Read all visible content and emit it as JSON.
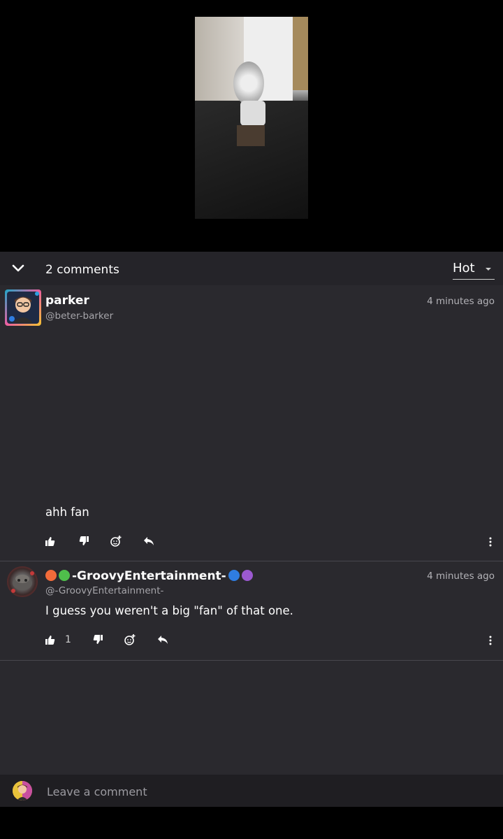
{
  "video": {
    "description_icon": "video-thumbnail"
  },
  "comments_header": {
    "count_label": "2 comments",
    "sort": {
      "selected": "Hot"
    }
  },
  "comments": [
    {
      "username": "parker",
      "handle": "@beter-barker",
      "time": "4 minutes ago",
      "body": "ahh fan",
      "likes": ""
    },
    {
      "username": "-GroovyEntertainment-",
      "username_prefix_emoji_colors": [
        "#f26b3a",
        "#4fbf4b"
      ],
      "username_suffix_emoji_colors": [
        "#2f7de1",
        "#9b59d0"
      ],
      "handle": "@-GroovyEntertainment-",
      "time": "4 minutes ago",
      "body": "I guess you weren't a big \"fan\" of that one.",
      "likes": "1"
    }
  ],
  "composer": {
    "placeholder": "Leave a comment"
  },
  "colors": {
    "panel": "#2a292e",
    "header": "#252429",
    "text": "#ffffff",
    "muted": "#a6a5aa"
  }
}
